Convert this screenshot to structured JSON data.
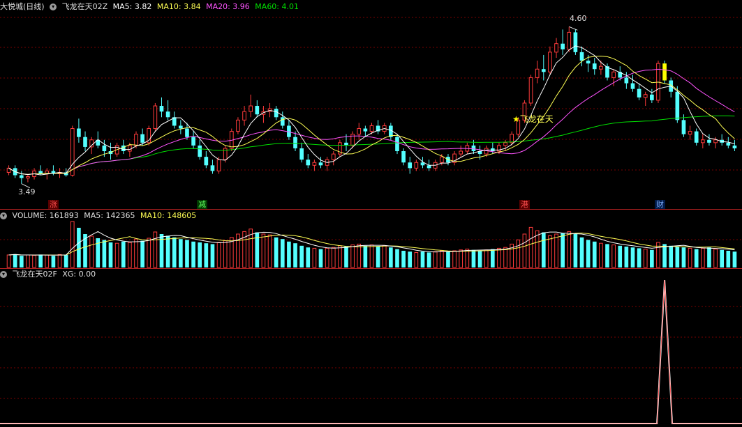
{
  "main_header": {
    "stock": "大悦城(日线)",
    "indicator": "飞龙在天02Z",
    "ma5": "MA5: 3.82",
    "ma10": "MA10: 3.84",
    "ma20": "MA20: 3.96",
    "ma60": "MA60: 4.01"
  },
  "volume_header": {
    "volume": "VOLUME: 161893",
    "ma5": "MA5: 142365",
    "ma10": "MA10: 148605"
  },
  "signal_header": {
    "label": "飞龙在天02F",
    "xg": "XG: 0.00"
  },
  "annotations": {
    "high_label": "4.60",
    "low_label": "3.49",
    "signal_label": "飞龙在天"
  },
  "badges": [
    {
      "text": "涨",
      "color": "#ff5050",
      "bg": "#5a0000"
    },
    {
      "text": "减",
      "color": "#60ff60",
      "bg": "#003a00"
    },
    {
      "text": "港",
      "color": "#ff5050",
      "bg": "#5a0000"
    },
    {
      "text": "财",
      "color": "#80b0ff",
      "bg": "#001a4a"
    }
  ],
  "colors": {
    "up": "#ff3b3b",
    "down": "#54ffff",
    "ma5": "#ffffff",
    "ma10": "#ffff54",
    "ma20": "#ff54ff",
    "ma60": "#00e000",
    "grid": "#7a0000"
  },
  "chart_data": {
    "type": "candlestick",
    "price_range": [
      3.4,
      4.7
    ],
    "candles": [
      [
        3.57,
        3.62,
        3.55,
        3.6
      ],
      [
        3.6,
        3.62,
        3.53,
        3.55
      ],
      [
        3.55,
        3.58,
        3.49,
        3.53
      ],
      [
        3.53,
        3.56,
        3.5,
        3.54
      ],
      [
        3.54,
        3.6,
        3.52,
        3.58
      ],
      [
        3.58,
        3.62,
        3.55,
        3.56
      ],
      [
        3.56,
        3.6,
        3.52,
        3.58
      ],
      [
        3.58,
        3.62,
        3.55,
        3.56
      ],
      [
        3.56,
        3.6,
        3.53,
        3.57
      ],
      [
        3.57,
        3.6,
        3.54,
        3.55
      ],
      [
        3.55,
        3.9,
        3.54,
        3.88
      ],
      [
        3.88,
        3.95,
        3.78,
        3.82
      ],
      [
        3.82,
        3.86,
        3.72,
        3.75
      ],
      [
        3.75,
        3.82,
        3.7,
        3.8
      ],
      [
        3.8,
        3.86,
        3.74,
        3.76
      ],
      [
        3.76,
        3.8,
        3.68,
        3.72
      ],
      [
        3.72,
        3.78,
        3.66,
        3.7
      ],
      [
        3.7,
        3.78,
        3.68,
        3.76
      ],
      [
        3.76,
        3.8,
        3.7,
        3.72
      ],
      [
        3.72,
        3.78,
        3.68,
        3.76
      ],
      [
        3.76,
        3.86,
        3.74,
        3.84
      ],
      [
        3.84,
        3.88,
        3.76,
        3.78
      ],
      [
        3.78,
        3.9,
        3.76,
        3.88
      ],
      [
        3.88,
        4.06,
        3.86,
        4.04
      ],
      [
        4.04,
        4.1,
        3.96,
        4.0
      ],
      [
        4.0,
        4.08,
        3.94,
        3.96
      ],
      [
        3.96,
        4.0,
        3.88,
        3.9
      ],
      [
        3.9,
        3.94,
        3.84,
        3.88
      ],
      [
        3.88,
        3.92,
        3.8,
        3.82
      ],
      [
        3.82,
        3.86,
        3.74,
        3.76
      ],
      [
        3.76,
        3.8,
        3.66,
        3.68
      ],
      [
        3.68,
        3.72,
        3.6,
        3.62
      ],
      [
        3.62,
        3.66,
        3.56,
        3.58
      ],
      [
        3.58,
        3.68,
        3.56,
        3.66
      ],
      [
        3.66,
        3.76,
        3.64,
        3.74
      ],
      [
        3.74,
        3.88,
        3.72,
        3.86
      ],
      [
        3.86,
        3.96,
        3.84,
        3.94
      ],
      [
        3.94,
        4.04,
        3.9,
        4.0
      ],
      [
        4.0,
        4.12,
        3.96,
        4.04
      ],
      [
        4.04,
        4.08,
        3.96,
        3.98
      ],
      [
        3.98,
        4.04,
        3.92,
        4.0
      ],
      [
        4.0,
        4.06,
        3.96,
        4.02
      ],
      [
        4.02,
        4.04,
        3.94,
        3.96
      ],
      [
        3.96,
        4.0,
        3.88,
        3.9
      ],
      [
        3.9,
        3.94,
        3.8,
        3.82
      ],
      [
        3.82,
        3.86,
        3.72,
        3.74
      ],
      [
        3.74,
        3.78,
        3.64,
        3.66
      ],
      [
        3.66,
        3.7,
        3.6,
        3.62
      ],
      [
        3.62,
        3.66,
        3.58,
        3.64
      ],
      [
        3.64,
        3.68,
        3.6,
        3.62
      ],
      [
        3.62,
        3.68,
        3.58,
        3.66
      ],
      [
        3.66,
        3.72,
        3.62,
        3.7
      ],
      [
        3.7,
        3.8,
        3.68,
        3.78
      ],
      [
        3.78,
        3.84,
        3.72,
        3.76
      ],
      [
        3.76,
        3.86,
        3.74,
        3.84
      ],
      [
        3.84,
        3.92,
        3.8,
        3.88
      ],
      [
        3.88,
        3.9,
        3.82,
        3.86
      ],
      [
        3.86,
        3.92,
        3.84,
        3.9
      ],
      [
        3.9,
        3.94,
        3.84,
        3.86
      ],
      [
        3.86,
        3.92,
        3.84,
        3.9
      ],
      [
        3.9,
        3.92,
        3.8,
        3.82
      ],
      [
        3.82,
        3.84,
        3.7,
        3.72
      ],
      [
        3.72,
        3.74,
        3.62,
        3.64
      ],
      [
        3.64,
        3.68,
        3.56,
        3.6
      ],
      [
        3.6,
        3.66,
        3.58,
        3.64
      ],
      [
        3.64,
        3.68,
        3.6,
        3.62
      ],
      [
        3.62,
        3.66,
        3.58,
        3.6
      ],
      [
        3.6,
        3.66,
        3.58,
        3.64
      ],
      [
        3.64,
        3.7,
        3.62,
        3.68
      ],
      [
        3.68,
        3.7,
        3.62,
        3.64
      ],
      [
        3.64,
        3.72,
        3.62,
        3.7
      ],
      [
        3.7,
        3.76,
        3.68,
        3.72
      ],
      [
        3.72,
        3.78,
        3.7,
        3.76
      ],
      [
        3.76,
        3.8,
        3.7,
        3.72
      ],
      [
        3.72,
        3.76,
        3.66,
        3.7
      ],
      [
        3.7,
        3.76,
        3.68,
        3.74
      ],
      [
        3.74,
        3.78,
        3.7,
        3.72
      ],
      [
        3.72,
        3.78,
        3.7,
        3.76
      ],
      [
        3.76,
        3.8,
        3.72,
        3.78
      ],
      [
        3.78,
        3.86,
        3.76,
        3.84
      ],
      [
        3.84,
        3.96,
        3.82,
        3.94
      ],
      [
        3.94,
        4.08,
        3.92,
        4.06
      ],
      [
        4.06,
        4.26,
        4.04,
        4.24
      ],
      [
        4.24,
        4.36,
        4.2,
        4.3
      ],
      [
        4.3,
        4.4,
        4.22,
        4.28
      ],
      [
        4.28,
        4.46,
        4.26,
        4.42
      ],
      [
        4.42,
        4.52,
        4.38,
        4.48
      ],
      [
        4.48,
        4.58,
        4.4,
        4.44
      ],
      [
        4.44,
        4.6,
        4.42,
        4.56
      ],
      [
        4.56,
        4.58,
        4.4,
        4.42
      ],
      [
        4.42,
        4.46,
        4.32,
        4.36
      ],
      [
        4.36,
        4.4,
        4.28,
        4.34
      ],
      [
        4.34,
        4.38,
        4.26,
        4.3
      ],
      [
        4.3,
        4.36,
        4.26,
        4.32
      ],
      [
        4.32,
        4.34,
        4.22,
        4.24
      ],
      [
        4.24,
        4.3,
        4.18,
        4.28
      ],
      [
        4.28,
        4.32,
        4.22,
        4.24
      ],
      [
        4.24,
        4.28,
        4.16,
        4.2
      ],
      [
        4.2,
        4.26,
        4.14,
        4.16
      ],
      [
        4.16,
        4.2,
        4.08,
        4.1
      ],
      [
        4.1,
        4.14,
        4.04,
        4.12
      ],
      [
        4.12,
        4.16,
        4.06,
        4.08
      ],
      [
        4.08,
        4.36,
        4.06,
        4.34
      ],
      [
        4.34,
        4.36,
        4.2,
        4.22
      ],
      [
        4.22,
        4.24,
        4.1,
        4.14
      ],
      [
        4.14,
        4.18,
        3.92,
        3.94
      ],
      [
        3.94,
        3.98,
        3.82,
        3.84
      ],
      [
        3.84,
        3.9,
        3.8,
        3.86
      ],
      [
        3.86,
        3.88,
        3.76,
        3.78
      ],
      [
        3.78,
        3.84,
        3.74,
        3.8
      ],
      [
        3.8,
        3.84,
        3.76,
        3.78
      ],
      [
        3.78,
        3.82,
        3.74,
        3.8
      ],
      [
        3.8,
        3.84,
        3.76,
        3.78
      ],
      [
        3.78,
        3.82,
        3.74,
        3.76
      ],
      [
        3.76,
        3.8,
        3.72,
        3.74
      ]
    ],
    "volumes": [
      30,
      32,
      28,
      30,
      29,
      31,
      30,
      28,
      31,
      30,
      110,
      95,
      80,
      75,
      70,
      66,
      60,
      58,
      62,
      60,
      68,
      64,
      70,
      85,
      80,
      76,
      72,
      68,
      66,
      62,
      60,
      58,
      56,
      60,
      64,
      72,
      80,
      86,
      92,
      84,
      80,
      78,
      72,
      68,
      62,
      58,
      52,
      48,
      46,
      44,
      46,
      48,
      52,
      50,
      54,
      56,
      52,
      54,
      50,
      52,
      48,
      44,
      40,
      38,
      36,
      38,
      36,
      38,
      40,
      38,
      40,
      42,
      44,
      42,
      40,
      42,
      44,
      46,
      48,
      56,
      66,
      80,
      96,
      88,
      84,
      76,
      80,
      82,
      86,
      80,
      72,
      66,
      62,
      58,
      56,
      54,
      52,
      50,
      48,
      46,
      44,
      42,
      60,
      56,
      52,
      50,
      48,
      46,
      44,
      46,
      48,
      44,
      42,
      40,
      38
    ],
    "signal_index": 103,
    "xg_value": 0.0
  }
}
